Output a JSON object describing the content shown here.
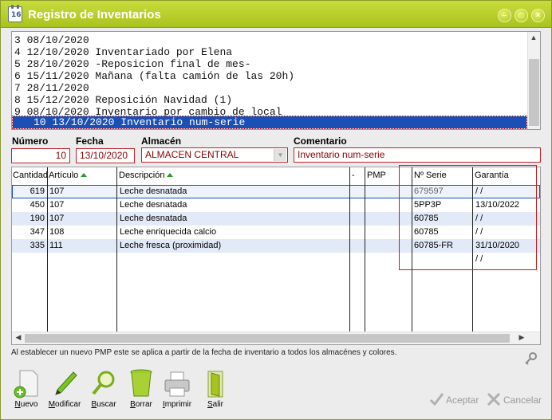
{
  "window": {
    "title": "Registro de Inventarios",
    "icon_number": "16",
    "controls": [
      "minimize-icon",
      "maximize-icon",
      "close-icon"
    ]
  },
  "inventory_list": {
    "rows": [
      "3 08/10/2020",
      "4 12/10/2020 Inventariado por Elena",
      "5 28/10/2020 -Reposicion final de mes-",
      "6 15/11/2020 Mañana (falta camión de las 20h)",
      "7 28/11/2020",
      "8 15/12/2020 Reposición Navidad (1)",
      "9 08/10/2020 Inventario por cambio de local",
      "10 13/10/2020 Inventario num-serie"
    ],
    "selected_index": 7
  },
  "form": {
    "numero_label": "Número",
    "numero_value": "10",
    "fecha_label": "Fecha",
    "fecha_value": "13/10/2020",
    "almacen_label": "Almacén",
    "almacen_value": "ALMACEN CENTRAL",
    "comentario_label": "Comentario",
    "comentario_value": "Inventario num-serie"
  },
  "grid": {
    "columns": {
      "cantidad": "Cantidad",
      "articulo": "Artículo",
      "descripcion": "Descripción",
      "dash": "-",
      "pmp": "PMP",
      "serie": "Nº Serie",
      "garantia": "Garantía"
    },
    "rows": [
      {
        "cantidad": "619",
        "articulo": "107",
        "descripcion": "Leche desnatada",
        "serie": "679597",
        "garantia": "/ /"
      },
      {
        "cantidad": "450",
        "articulo": "107",
        "descripcion": "Leche desnatada",
        "serie": "5PP3P",
        "garantia": "13/10/2022"
      },
      {
        "cantidad": "190",
        "articulo": "107",
        "descripcion": "Leche desnatada",
        "serie": "60785",
        "garantia": "/ /"
      },
      {
        "cantidad": "347",
        "articulo": "108",
        "descripcion": "Leche enriquecida calcio",
        "serie": "60785",
        "garantia": "/ /"
      },
      {
        "cantidad": "335",
        "articulo": "111",
        "descripcion": "Leche fresca (proximidad)",
        "serie": "60785-FR",
        "garantia": "31/10/2020"
      },
      {
        "cantidad": "",
        "articulo": "",
        "descripcion": "",
        "serie": "",
        "garantia": "/ /"
      }
    ]
  },
  "info_text": "Al establecer un nuevo PMP este se aplica a partir de la fecha de inventario a todos los almacénes y colores.",
  "toolbar": {
    "nuevo": "Nuevo",
    "modificar": "Modificar",
    "buscar": "Buscar",
    "borrar": "Borrar",
    "imprimir": "Imprimir",
    "salir": "Salir"
  },
  "actions": {
    "aceptar": "Aceptar",
    "cancelar": "Cancelar"
  },
  "colors": {
    "titlebar": "#a9c31e",
    "selection": "#1a4fb5",
    "field_border": "#c0222b",
    "highlight_box": "#d01818"
  }
}
